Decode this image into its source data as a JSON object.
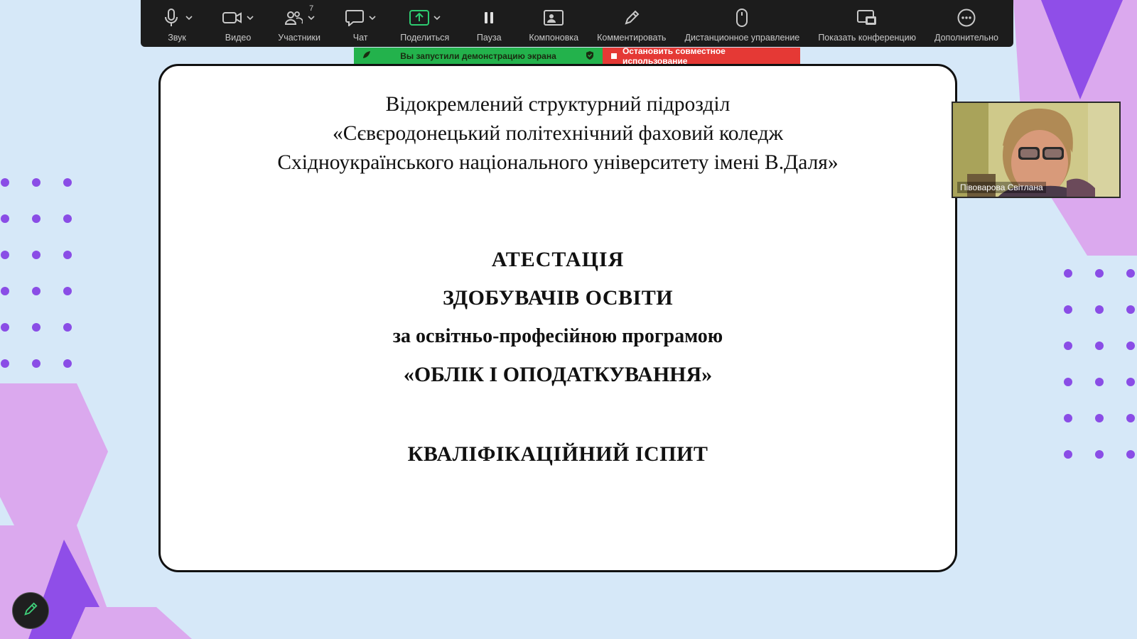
{
  "toolbar": {
    "audio_label": "Звук",
    "video_label": "Видео",
    "participants_label": "Участники",
    "participants_count": "7",
    "chat_label": "Чат",
    "share_label": "Поделиться",
    "pause_label": "Пауза",
    "layout_label": "Компоновка",
    "annotate_label": "Комментировать",
    "remote_control_label": "Дистанционное управление",
    "show_meeting_label": "Показать конференцию",
    "more_label": "Дополнительно"
  },
  "share_banner": {
    "status_text": "Вы запустили демонстрацию экрана",
    "stop_label": "Остановить совместное использование"
  },
  "slide": {
    "institution_lines": [
      "Відокремлений структурний підрозділ",
      "«Сєвєродонецький політехнічний фаховий коледж",
      "Східноукраїнського національного університету імені В.Даля»"
    ],
    "title_lines": [
      "АТЕСТАЦІЯ",
      "ЗДОБУВАЧІВ ОСВІТИ",
      "за освітньо-професійною програмою",
      "«ОБЛІК І ОПОДАТКУВАННЯ»"
    ],
    "exam_title": "КВАЛІФІКАЦІЙНИЙ ІСПИТ"
  },
  "participant_video": {
    "name": "Півоварова Світлана"
  },
  "colors": {
    "toolbar_bg": "#1c1c1c",
    "share_green": "#23b24c",
    "stop_red": "#e53935",
    "background": "#d6e8f8",
    "accent_purple": "#8a4de6",
    "accent_pink": "#d9a6ec"
  },
  "icons": {
    "audio": "microphone-icon",
    "video": "camera-icon",
    "participants": "people-icon",
    "chat": "chat-bubble-icon",
    "share": "share-screen-icon",
    "pause": "pause-icon",
    "layout": "layout-icon",
    "annotate": "pencil-icon",
    "remote_control": "mouse-icon",
    "show_meeting": "show-meeting-icon",
    "more": "more-dots-icon"
  }
}
